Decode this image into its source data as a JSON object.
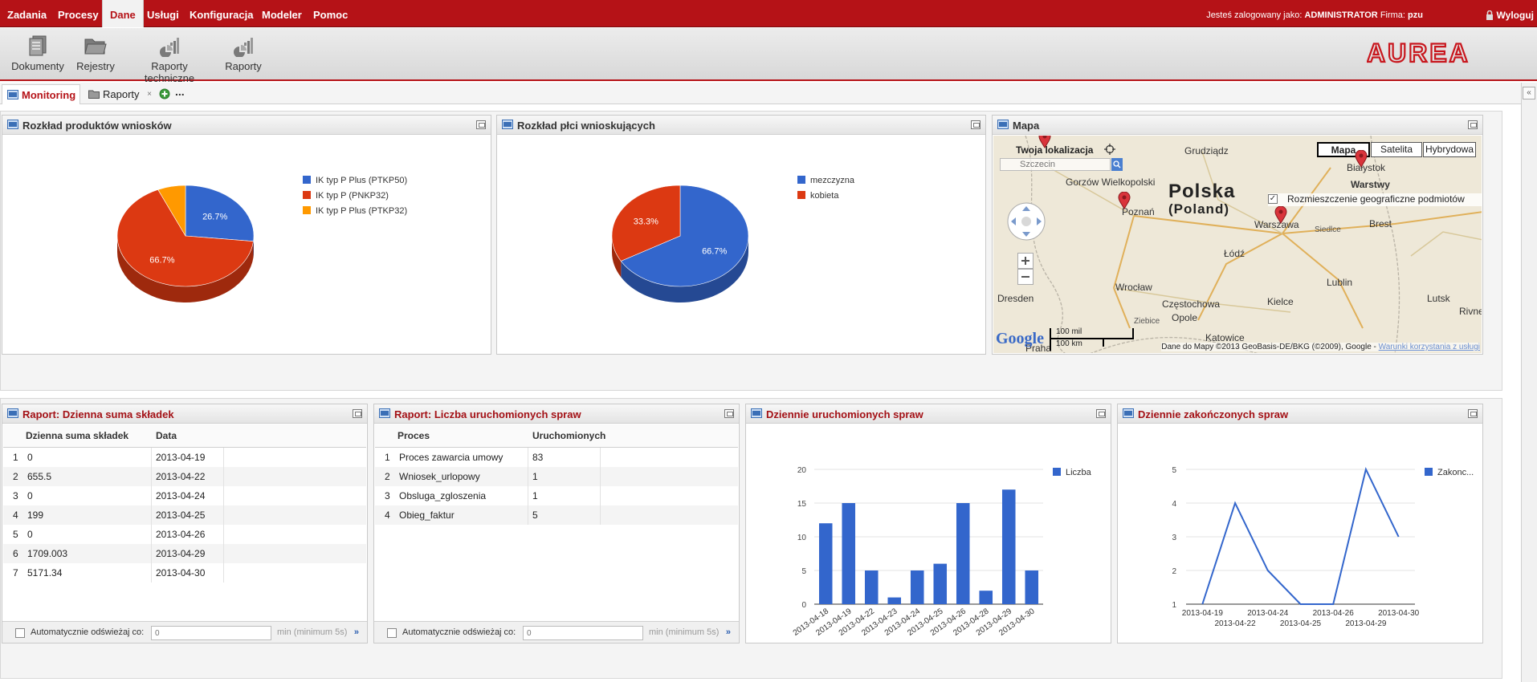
{
  "menu": {
    "items": [
      "Zadania",
      "Procesy",
      "Dane",
      "Usługi",
      "Konfiguracja",
      "Modeler",
      "Pomoc"
    ],
    "active": "Dane",
    "login_prefix": "Jesteś zalogowany jako:",
    "user": "ADMINISTRATOR",
    "company_prefix": "Firma:",
    "company": "pzu",
    "logout": "Wyloguj"
  },
  "toolbar": {
    "items": [
      "Dokumenty",
      "Rejestry",
      "Raporty techniczne",
      "Raporty"
    ],
    "logo": "AUREA"
  },
  "tabs": {
    "items": [
      "Monitoring",
      "Raporty"
    ],
    "close": "×",
    "more": "..."
  },
  "colors": {
    "brand_red": "#b51217",
    "blue": "#3366cc",
    "orange_red": "#dc3912",
    "orange": "#ff9900"
  },
  "panels": {
    "products": {
      "title": "Rozkład produktów wniosków",
      "chart_data": {
        "type": "pie",
        "labels": [
          "IK typ P Plus (PTKP50)",
          "IK typ P (PNKP32)",
          "IK typ P Plus (PTKP32)"
        ],
        "values": [
          26.7,
          66.7,
          6.6
        ],
        "data_labels": [
          "26.7%",
          "66.7%",
          ""
        ],
        "colors": [
          "#3366cc",
          "#dc3912",
          "#ff9900"
        ],
        "legend": "right"
      }
    },
    "gender": {
      "title": "Rozkład płci wnioskujących",
      "chart_data": {
        "type": "pie",
        "labels": [
          "mezczyzna",
          "kobieta"
        ],
        "values": [
          66.7,
          33.3
        ],
        "data_labels": [
          "66.7%",
          "33.3%"
        ],
        "colors": [
          "#3366cc",
          "#dc3912"
        ],
        "legend": "right"
      }
    },
    "map": {
      "title": "Mapa",
      "location_label": "Twoja lokalizacja",
      "search_placeholder": "Szczecin",
      "types": [
        "Mapa",
        "Satelita",
        "Hybrydowa"
      ],
      "active_type": "Mapa",
      "layers_title": "Warstwy",
      "layer": "Rozmieszczenie geograficzne podmiotów",
      "country": "Polska",
      "country_native": "(Poland)",
      "cities": [
        "Gorzów Wielkopolski",
        "Poznań",
        "Grudziądz",
        "Białystok",
        "Warszawa",
        "Łódź",
        "Wrocław",
        "Lublin",
        "Dresden",
        "Częstochowa",
        "Kielce",
        "Opole",
        "Katowice",
        "Brest",
        "Siedlce",
        "Lutsk",
        "Rivne",
        "Praha",
        "Ziebice"
      ],
      "scale_mi": "100 mil",
      "scale_km": "100 km",
      "attribution": "Dane do Mapy ©2013 GeoBasis-DE/BKG (©2009), Google -",
      "terms": "Warunki korzystania z usługi",
      "google": "Google"
    },
    "daily_sum": {
      "title": "Raport: Dzienna suma składek",
      "columns": [
        "Dzienna suma składek",
        "Data"
      ],
      "rows": [
        [
          "1",
          "0",
          "2013-04-19"
        ],
        [
          "2",
          "655.5",
          "2013-04-22"
        ],
        [
          "3",
          "0",
          "2013-04-24"
        ],
        [
          "4",
          "199",
          "2013-04-25"
        ],
        [
          "5",
          "0",
          "2013-04-26"
        ],
        [
          "6",
          "1709.003",
          "2013-04-29"
        ],
        [
          "7",
          "5171.34",
          "2013-04-30"
        ]
      ]
    },
    "started_count": {
      "title": "Raport: Liczba uruchomionych spraw",
      "columns": [
        "Proces",
        "Uruchomionych"
      ],
      "rows": [
        [
          "1",
          "Proces zawarcia umowy",
          "83"
        ],
        [
          "2",
          "Wniosek_urlopowy",
          "1"
        ],
        [
          "3",
          "Obsluga_zgloszenia",
          "1"
        ],
        [
          "4",
          "Obieg_faktur",
          "5"
        ]
      ]
    },
    "footer": {
      "auto_refresh": "Automatycznie odświeżaj co:",
      "placeholder": "0",
      "hint": "min (minimum 5s)",
      "next": "»"
    },
    "daily_started": {
      "title": "Dziennie uruchomionych spraw",
      "chart_data": {
        "type": "bar",
        "categories": [
          "2013-04-18",
          "2013-04-19",
          "2013-04-22",
          "2013-04-23",
          "2013-04-24",
          "2013-04-25",
          "2013-04-26",
          "2013-04-28",
          "2013-04-29",
          "2013-04-30"
        ],
        "series": [
          {
            "name": "Liczba",
            "values": [
              12,
              15,
              5,
              1,
              5,
              6,
              15,
              2,
              17,
              5
            ],
            "color": "#3366cc"
          }
        ],
        "yticks": [
          "0",
          "5",
          "10",
          "15",
          "20"
        ],
        "ylim": [
          0,
          20
        ],
        "legend": "right"
      }
    },
    "daily_finished": {
      "title": "Dziennie zakończonych spraw",
      "chart_data": {
        "type": "line",
        "categories": [
          "2013-04-19",
          "2013-04-22",
          "2013-04-24",
          "2013-04-25",
          "2013-04-26",
          "2013-04-29",
          "2013-04-30"
        ],
        "series": [
          {
            "name": "Zakonc...",
            "values": [
              1,
              4,
              2,
              1,
              1,
              5,
              3
            ],
            "color": "#3366cc"
          }
        ],
        "yticks": [
          "1",
          "2",
          "3",
          "4",
          "5"
        ],
        "ylim": [
          1,
          5
        ],
        "legend": "right"
      }
    }
  }
}
